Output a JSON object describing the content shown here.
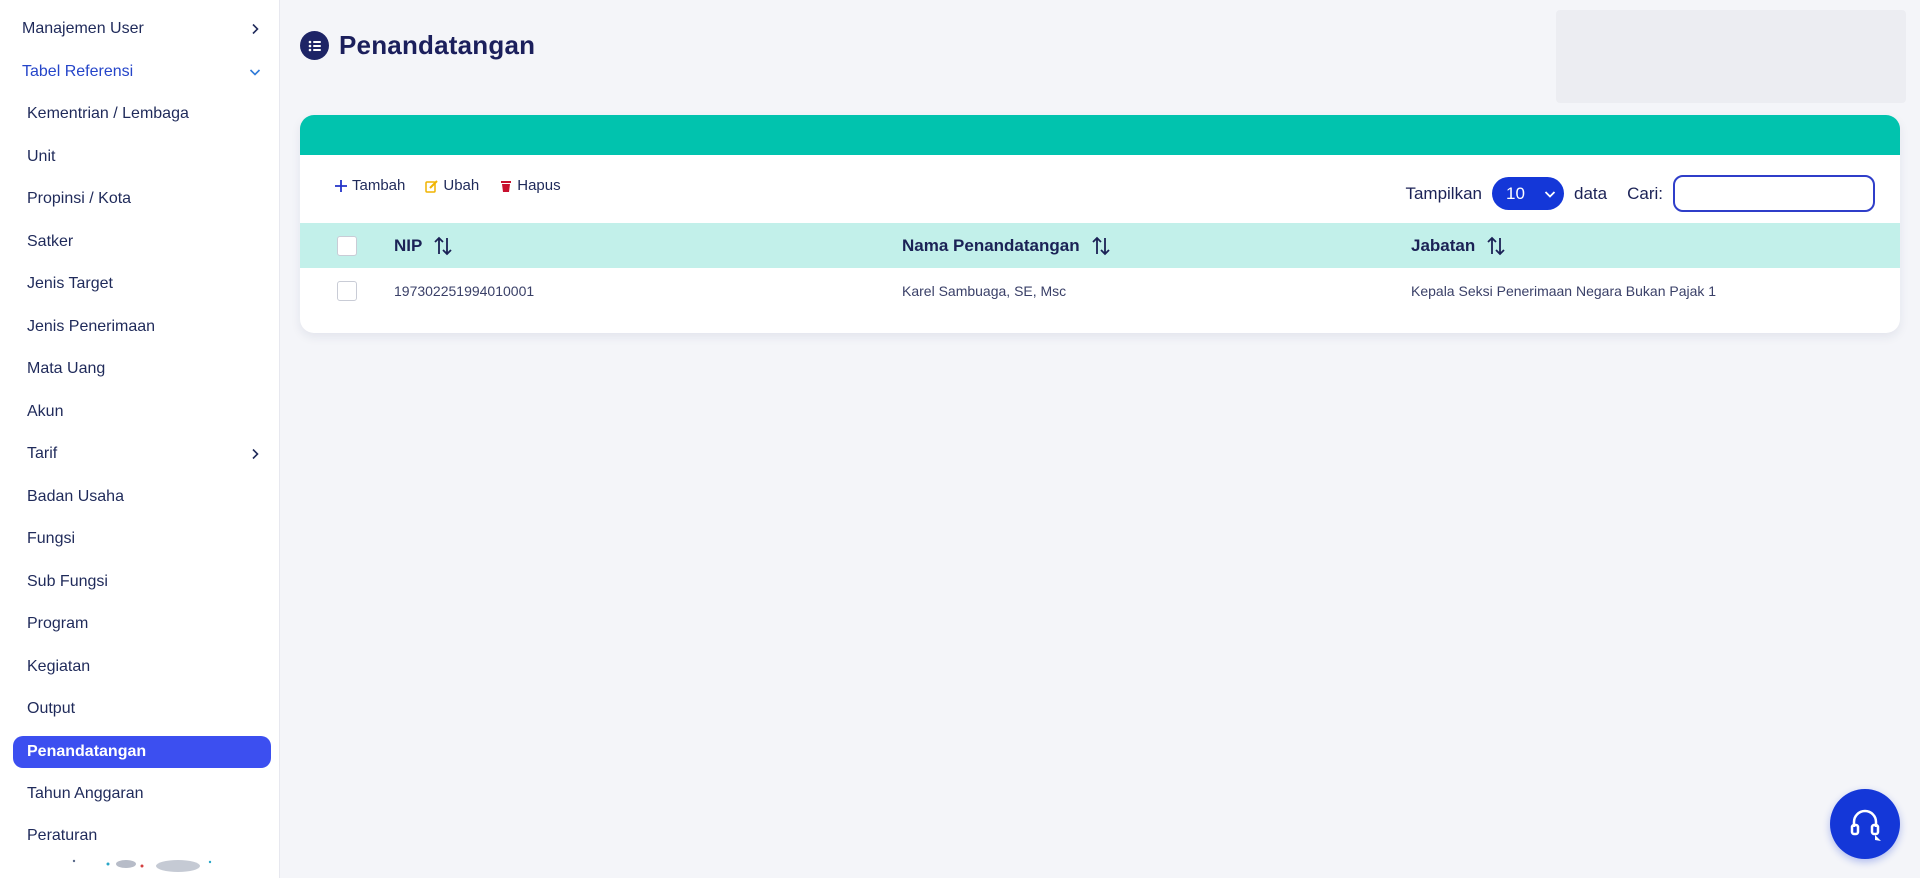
{
  "sidebar": {
    "items": [
      {
        "label": "Manajemen User",
        "chevron": "right"
      },
      {
        "label": "Tabel Referensi",
        "chevron": "down"
      },
      {
        "label": "Kementrian / Lembaga"
      },
      {
        "label": "Unit"
      },
      {
        "label": "Propinsi / Kota"
      },
      {
        "label": "Satker"
      },
      {
        "label": "Jenis Target"
      },
      {
        "label": "Jenis Penerimaan"
      },
      {
        "label": "Mata Uang"
      },
      {
        "label": "Akun"
      },
      {
        "label": "Tarif",
        "chevron": "right"
      },
      {
        "label": "Badan Usaha"
      },
      {
        "label": "Fungsi"
      },
      {
        "label": "Sub Fungsi"
      },
      {
        "label": "Program"
      },
      {
        "label": "Kegiatan"
      },
      {
        "label": "Output"
      },
      {
        "label": "Penandatangan",
        "active": true
      },
      {
        "label": "Tahun Anggaran"
      },
      {
        "label": "Peraturan"
      }
    ]
  },
  "page": {
    "title": "Penandatangan",
    "icon": "list-icon"
  },
  "toolbar": {
    "add_label": "Tambah",
    "edit_label": "Ubah",
    "delete_label": "Hapus"
  },
  "controls": {
    "show_label": "Tampilkan",
    "page_size": "10",
    "data_label": "data",
    "search_label": "Cari:",
    "search_value": ""
  },
  "table": {
    "columns": [
      "NIP",
      "Nama Penandatangan",
      "Jabatan"
    ],
    "rows": [
      {
        "nip": "197302251994010001",
        "nama": "Karel Sambuaga, SE, Msc",
        "jabatan": "Kepala Seksi Penerimaan Negara Bukan Pajak 1"
      }
    ]
  },
  "colors": {
    "accent": "#3c4ff0",
    "band": "#01c3ae",
    "header_row": "#c2f0ea",
    "primary": "#1437d8"
  }
}
